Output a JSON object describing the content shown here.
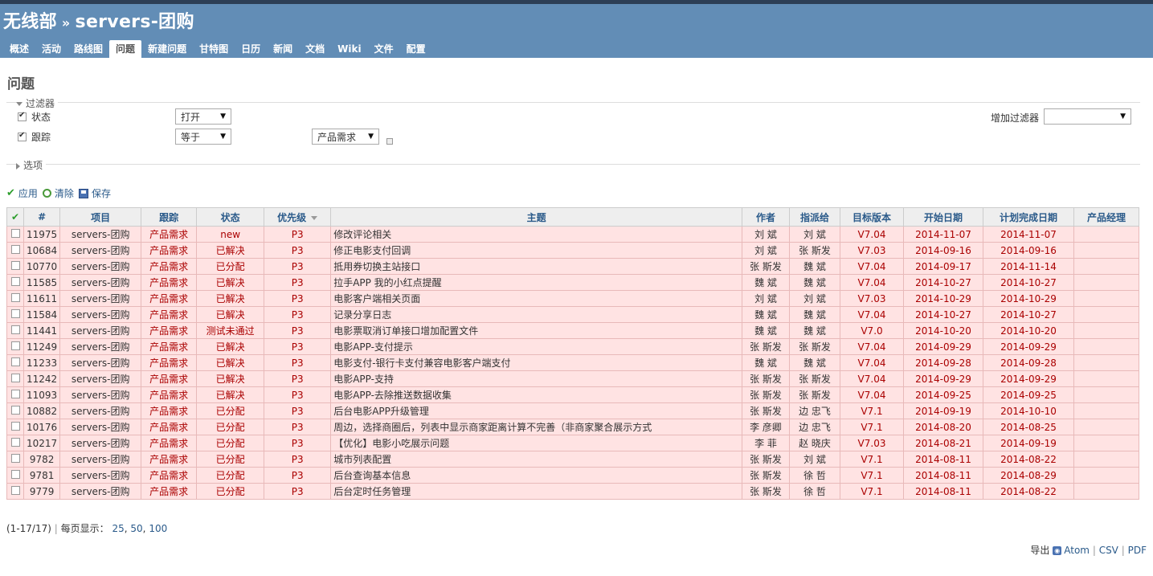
{
  "header": {
    "project": "无线部",
    "separator": "»",
    "subproject": "servers-团购"
  },
  "menu": [
    {
      "label": "概述",
      "selected": false
    },
    {
      "label": "活动",
      "selected": false
    },
    {
      "label": "路线图",
      "selected": false
    },
    {
      "label": "问题",
      "selected": true
    },
    {
      "label": "新建问题",
      "selected": false
    },
    {
      "label": "甘特图",
      "selected": false
    },
    {
      "label": "日历",
      "selected": false
    },
    {
      "label": "新闻",
      "selected": false
    },
    {
      "label": "文档",
      "selected": false
    },
    {
      "label": "Wiki",
      "selected": false
    },
    {
      "label": "文件",
      "selected": false
    },
    {
      "label": "配置",
      "selected": false
    }
  ],
  "page_title": "问题",
  "filters": {
    "legend": "过滤器",
    "rows": [
      {
        "label": "状态",
        "operator": "打开",
        "value": ""
      },
      {
        "label": "跟踪",
        "operator": "等于",
        "value": "产品需求"
      }
    ],
    "add_filter_label": "增加过滤器",
    "add_filter_value": ""
  },
  "options_legend": "选项",
  "actions": {
    "apply": "应用",
    "clear": "清除",
    "save": "保存"
  },
  "table": {
    "headers": [
      "#",
      "项目",
      "跟踪",
      "状态",
      "优先级",
      "主题",
      "作者",
      "指派给",
      "目标版本",
      "开始日期",
      "计划完成日期",
      "产品经理"
    ],
    "rows": [
      [
        "11975",
        "servers-团购",
        "产品需求",
        "new",
        "P3",
        "修改评论相关",
        "刘 斌",
        "刘 斌",
        "V7.04",
        "2014-11-07",
        "2014-11-07",
        ""
      ],
      [
        "10684",
        "servers-团购",
        "产品需求",
        "已解决",
        "P3",
        "修正电影支付回调",
        "刘 斌",
        "张 斯发",
        "V7.03",
        "2014-09-16",
        "2014-09-16",
        ""
      ],
      [
        "10770",
        "servers-团购",
        "产品需求",
        "已分配",
        "P3",
        "抵用券切换主站接口",
        "张 斯发",
        "魏 斌",
        "V7.04",
        "2014-09-17",
        "2014-11-14",
        ""
      ],
      [
        "11585",
        "servers-团购",
        "产品需求",
        "已解决",
        "P3",
        "拉手APP 我的小红点提醒",
        "魏 斌",
        "魏 斌",
        "V7.04",
        "2014-10-27",
        "2014-10-27",
        ""
      ],
      [
        "11611",
        "servers-团购",
        "产品需求",
        "已解决",
        "P3",
        "电影客户端相关页面",
        "刘 斌",
        "刘 斌",
        "V7.03",
        "2014-10-29",
        "2014-10-29",
        ""
      ],
      [
        "11584",
        "servers-团购",
        "产品需求",
        "已解决",
        "P3",
        "记录分享日志",
        "魏 斌",
        "魏 斌",
        "V7.04",
        "2014-10-27",
        "2014-10-27",
        ""
      ],
      [
        "11441",
        "servers-团购",
        "产品需求",
        "测试未通过",
        "P3",
        "电影票取消订单接口增加配置文件",
        "魏 斌",
        "魏 斌",
        "V7.0",
        "2014-10-20",
        "2014-10-20",
        ""
      ],
      [
        "11249",
        "servers-团购",
        "产品需求",
        "已解决",
        "P3",
        "电影APP-支付提示",
        "张 斯发",
        "张 斯发",
        "V7.04",
        "2014-09-29",
        "2014-09-29",
        ""
      ],
      [
        "11233",
        "servers-团购",
        "产品需求",
        "已解决",
        "P3",
        "电影支付-银行卡支付兼容电影客户端支付",
        "魏 斌",
        "魏 斌",
        "V7.04",
        "2014-09-28",
        "2014-09-28",
        ""
      ],
      [
        "11242",
        "servers-团购",
        "产品需求",
        "已解决",
        "P3",
        "电影APP-支持",
        "张 斯发",
        "张 斯发",
        "V7.04",
        "2014-09-29",
        "2014-09-29",
        ""
      ],
      [
        "11093",
        "servers-团购",
        "产品需求",
        "已解决",
        "P3",
        "电影APP-去除推送数据收集",
        "张 斯发",
        "张 斯发",
        "V7.04",
        "2014-09-25",
        "2014-09-25",
        ""
      ],
      [
        "10882",
        "servers-团购",
        "产品需求",
        "已分配",
        "P3",
        "后台电影APP升级管理",
        "张 斯发",
        "边 忠飞",
        "V7.1",
        "2014-09-19",
        "2014-10-10",
        ""
      ],
      [
        "10176",
        "servers-团购",
        "产品需求",
        "已分配",
        "P3",
        "周边，选择商圈后，列表中显示商家距离计算不完善（非商家聚合展示方式",
        "李 彦卿",
        "边 忠飞",
        "V7.1",
        "2014-08-20",
        "2014-08-25",
        ""
      ],
      [
        "10217",
        "servers-团购",
        "产品需求",
        "已分配",
        "P3",
        "【优化】电影小吃展示问题",
        "李 菲",
        "赵 晓庆",
        "V7.03",
        "2014-08-21",
        "2014-09-19",
        ""
      ],
      [
        "9782",
        "servers-团购",
        "产品需求",
        "已分配",
        "P3",
        "城市列表配置",
        "张 斯发",
        "刘 斌",
        "V7.1",
        "2014-08-11",
        "2014-08-22",
        ""
      ],
      [
        "9781",
        "servers-团购",
        "产品需求",
        "已分配",
        "P3",
        "后台查询基本信息",
        "张 斯发",
        "徐 哲",
        "V7.1",
        "2014-08-11",
        "2014-08-29",
        ""
      ],
      [
        "9779",
        "servers-团购",
        "产品需求",
        "已分配",
        "P3",
        "后台定时任务管理",
        "张 斯发",
        "徐 哲",
        "V7.1",
        "2014-08-11",
        "2014-08-22",
        ""
      ]
    ]
  },
  "pagination": {
    "summary": "(1-17/17)",
    "per_page_label": "每页显示：",
    "options": [
      "25",
      "50",
      "100"
    ]
  },
  "export": {
    "label": "导出",
    "links": [
      "Atom",
      "CSV",
      "PDF"
    ]
  },
  "colors": {
    "header_bg": "#628db6",
    "row_bg": "#ffe3e3",
    "link": "#2a5a8a"
  }
}
